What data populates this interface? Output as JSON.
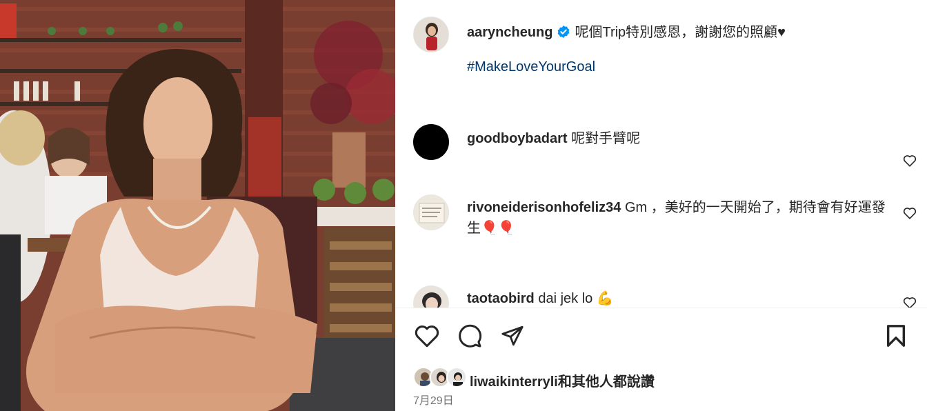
{
  "post": {
    "author": "aaryncheung",
    "caption": "呢個Trip特別感恩，謝謝您的照顧♥",
    "hashtag": "#MakeLoveYourGoal"
  },
  "comments": [
    {
      "username": "goodboybadart",
      "text": "呢對手臂呢"
    },
    {
      "username": "rivoneiderisonhofeliz34",
      "text": "Gm ，美好的一天開始了，期待會有好運發生🎈🎈"
    },
    {
      "username": "taotaobird",
      "text": "dai jek lo 💪"
    }
  ],
  "likes": {
    "text_prefix": "liwaikinterryli",
    "text_suffix": "和其他人都說讚"
  },
  "date": "7月29日",
  "icons": {
    "like": "heart-outline-icon",
    "comment": "speech-bubble-icon",
    "share": "paper-plane-icon",
    "save": "bookmark-icon",
    "verified": "verified-badge-icon"
  },
  "colors": {
    "verified": "#0095f6",
    "hashtag": "#00376b",
    "secondary_text": "#737373"
  }
}
